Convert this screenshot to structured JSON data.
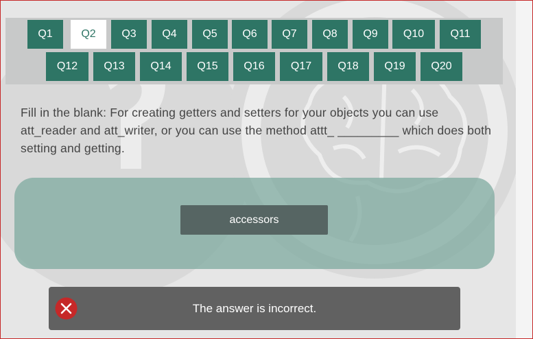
{
  "nav": {
    "row1": [
      "Q1",
      "Q2",
      "Q3",
      "Q4",
      "Q5",
      "Q6",
      "Q7",
      "Q8",
      "Q9",
      "Q10",
      "Q11"
    ],
    "row2": [
      "Q12",
      "Q13",
      "Q14",
      "Q15",
      "Q16",
      "Q17",
      "Q18",
      "Q19",
      "Q20"
    ],
    "active": "Q2"
  },
  "question": {
    "text": "Fill in the blank: For creating getters and setters for your objects you can use att_reader and att_writer, or you can use the method attt_ _________ which does both setting and getting."
  },
  "answer": {
    "value": "accessors"
  },
  "feedback": {
    "message": "The answer is incorrect.",
    "status": "incorrect",
    "icon": "error-x-icon"
  },
  "colors": {
    "accent": "#2e7565",
    "feedback_bg": "#616161",
    "error": "#c62828"
  }
}
